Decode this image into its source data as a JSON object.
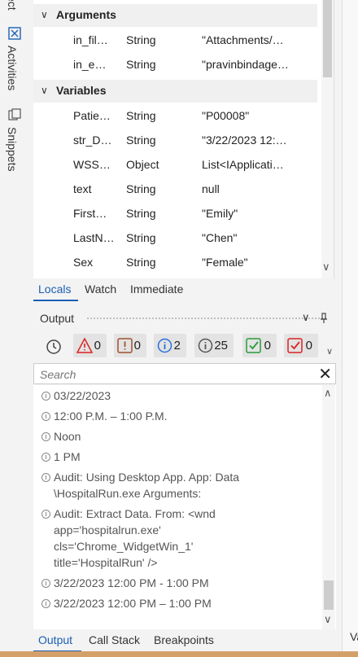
{
  "sidebar": {
    "items": [
      {
        "label": "ect",
        "icon": "object-icon"
      },
      {
        "label": "Activities",
        "icon": "activities-icon"
      },
      {
        "label": "Snippets",
        "icon": "snippets-icon"
      }
    ]
  },
  "locals": {
    "sections": [
      {
        "label": "Arguments",
        "rows": [
          {
            "name": "in_fil…",
            "type": "String",
            "value": "\"Attachments/…"
          },
          {
            "name": "in_e…",
            "type": "String",
            "value": "\"pravinbindage…"
          }
        ]
      },
      {
        "label": "Variables",
        "rows": [
          {
            "name": "Patie…",
            "type": "String",
            "value": "\"P00008\""
          },
          {
            "name": "str_D…",
            "type": "String",
            "value": "\"3/22/2023 12:…"
          },
          {
            "name": "WSS…",
            "type": "Object",
            "value": "List<IApplicati…"
          },
          {
            "name": "text",
            "type": "String",
            "value": "null"
          },
          {
            "name": "First…",
            "type": "String",
            "value": "\"Emily\""
          },
          {
            "name": "LastN…",
            "type": "String",
            "value": "\"Chen\""
          },
          {
            "name": "Sex",
            "type": "String",
            "value": "\"Female\""
          }
        ]
      }
    ]
  },
  "debug_tabs": [
    "Locals",
    "Watch",
    "Immediate"
  ],
  "output": {
    "title": "Output",
    "filters": [
      {
        "icon": "clock-icon",
        "count": ""
      },
      {
        "icon": "error-icon",
        "count": "0"
      },
      {
        "icon": "warning-icon",
        "count": "0"
      },
      {
        "icon": "info-icon",
        "count": "2"
      },
      {
        "icon": "trace-icon",
        "count": "25"
      },
      {
        "icon": "success-icon",
        "count": "0"
      },
      {
        "icon": "failure-icon",
        "count": "0"
      }
    ],
    "search_placeholder": "Search",
    "lines": [
      "03/22/2023",
      "12:00 P.M. – 1:00 P.M.",
      "Noon",
      "1 PM",
      "Audit: Using Desktop App. App: Data\n\\HospitalRun.exe Arguments:",
      "Audit: Extract Data. From: <wnd\napp='hospitalrun.exe'\ncls='Chrome_WidgetWin_1'\ntitle='HospitalRun' />",
      "3/22/2023 12:00 PM - 1:00 PM",
      "3/22/2023 12:00 PM – 1:00 PM"
    ]
  },
  "bottom_tabs": [
    "Output",
    "Call Stack",
    "Breakpoints"
  ],
  "right_panel_label": "Va"
}
